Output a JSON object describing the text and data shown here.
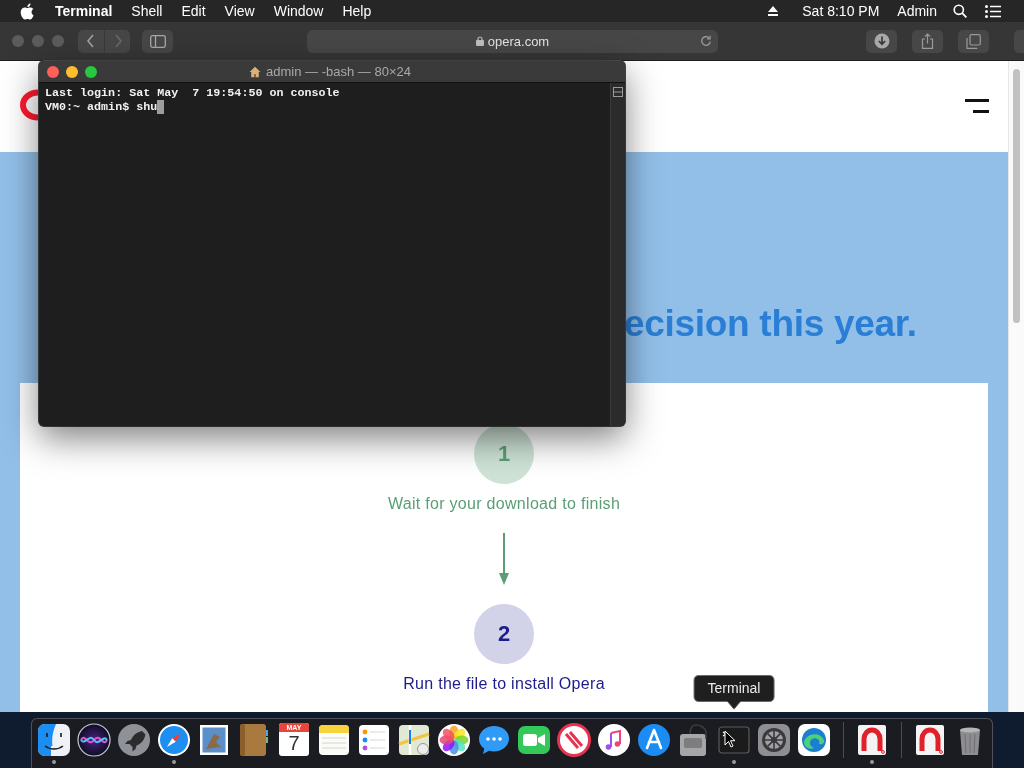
{
  "menu_bar": {
    "app_name": "Terminal",
    "menus": [
      "Shell",
      "Edit",
      "View",
      "Window",
      "Help"
    ],
    "clock": "Sat 8:10 PM",
    "user": "Admin"
  },
  "browser": {
    "active": false,
    "address": "opera.com",
    "page": {
      "heading": "ecision this year.",
      "steps": [
        {
          "number": "1",
          "label": "Wait for your download to finish",
          "color": "#5a9e74"
        },
        {
          "number": "2",
          "label": "Run the file to install Opera",
          "color": "#1c1c8c"
        }
      ]
    }
  },
  "terminal": {
    "active": true,
    "title": "admin — -bash — 80×24",
    "lines": [
      "Last login: Sat May  7 19:54:50 on console",
      "VM0:~ admin$ shu"
    ]
  },
  "dock": {
    "items": [
      {
        "kind": "finder",
        "running": true
      },
      {
        "kind": "siri",
        "running": false
      },
      {
        "kind": "launchpad",
        "running": false
      },
      {
        "kind": "safari",
        "running": true
      },
      {
        "kind": "mail",
        "running": false
      },
      {
        "kind": "contacts",
        "running": false
      },
      {
        "kind": "calendar",
        "running": false,
        "month": "MAY",
        "day": "7"
      },
      {
        "kind": "notes",
        "running": false
      },
      {
        "kind": "reminders",
        "running": false
      },
      {
        "kind": "maps",
        "running": false
      },
      {
        "kind": "photos",
        "running": false
      },
      {
        "kind": "messages",
        "running": false
      },
      {
        "kind": "facetime",
        "running": false
      },
      {
        "kind": "news",
        "running": false
      },
      {
        "kind": "music",
        "running": false
      },
      {
        "kind": "appstore",
        "running": false
      },
      {
        "kind": "diskutility",
        "running": false
      },
      {
        "kind": "terminal",
        "running": true,
        "tooltip": "Terminal"
      },
      {
        "kind": "preferences",
        "running": false
      },
      {
        "kind": "edge",
        "running": false
      },
      {
        "kind": "separator"
      },
      {
        "kind": "installer",
        "running": true
      },
      {
        "kind": "separator"
      },
      {
        "kind": "installer",
        "running": false
      },
      {
        "kind": "trash",
        "running": false
      }
    ]
  }
}
